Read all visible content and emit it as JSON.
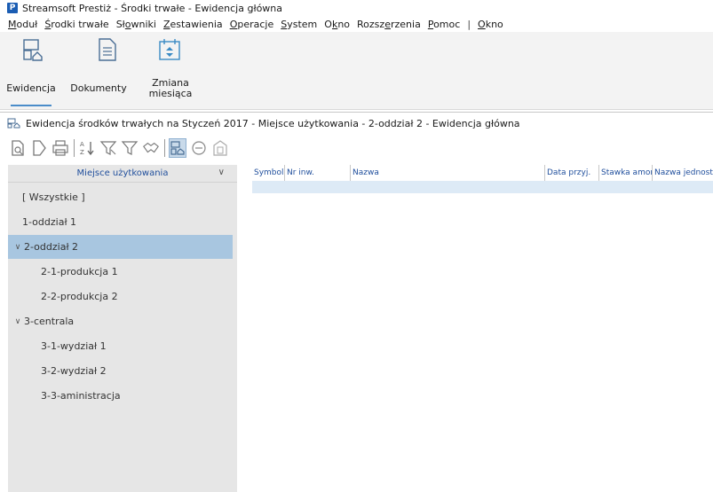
{
  "window": {
    "logo_letter": "P",
    "title": "Streamsoft Prestiż - Środki trwałe - Ewidencja główna"
  },
  "menu": [
    {
      "pre": "",
      "ul": "M",
      "post": "oduł"
    },
    {
      "pre": "",
      "ul": "Ś",
      "post": "rodki trwałe"
    },
    {
      "pre": "Sł",
      "ul": "o",
      "post": "wniki"
    },
    {
      "pre": "",
      "ul": "Z",
      "post": "estawienia"
    },
    {
      "pre": "",
      "ul": "O",
      "post": "peracje"
    },
    {
      "pre": "",
      "ul": "S",
      "post": "ystem"
    },
    {
      "pre": "O",
      "ul": "k",
      "post": "no"
    },
    {
      "pre": "Rozsz",
      "ul": "e",
      "post": "rzenia"
    },
    {
      "pre": "",
      "ul": "P",
      "post": "omoc"
    },
    {
      "sep": "|"
    },
    {
      "pre": "",
      "ul": "O",
      "post": "kno"
    }
  ],
  "ribbon": {
    "buttons": [
      {
        "label": "Ewidencja",
        "icon": "asset-register-icon"
      },
      {
        "label": "Dokumenty",
        "icon": "document-icon"
      },
      {
        "label": "Zmiana\nmiesiąca",
        "icon": "calendar-change-icon"
      }
    ]
  },
  "view": {
    "header": "Ewidencja środków trwałych na Styczeń 2017 - Miejsce użytkowania - 2-oddział 2 - Ewidencja główna"
  },
  "toolbar": {
    "icons": [
      "preview-icon",
      "new-document-icon",
      "print-icon",
      "sort-az-icon",
      "filter-icon",
      "filter-clear-icon",
      "handshake-icon",
      "asset-view-icon",
      "minus-circle-icon",
      "building-icon"
    ]
  },
  "left_panel": {
    "header": "Miejsce użytkowania",
    "items": [
      {
        "label": "[ Wszystkie ]",
        "indent": 0,
        "twisty": ""
      },
      {
        "label": "1-oddział 1",
        "indent": 0,
        "twisty": ""
      },
      {
        "label": "2-oddział 2",
        "indent": 0,
        "twisty": "∨",
        "selected": true
      },
      {
        "label": "2-1-produkcja 1",
        "indent": 1,
        "twisty": ""
      },
      {
        "label": "2-2-produkcja 2",
        "indent": 1,
        "twisty": ""
      },
      {
        "label": "3-centrala",
        "indent": 0,
        "twisty": "∨"
      },
      {
        "label": "3-1-wydział 1",
        "indent": 1,
        "twisty": ""
      },
      {
        "label": "3-2-wydział 2",
        "indent": 1,
        "twisty": ""
      },
      {
        "label": "3-3-aministracja",
        "indent": 1,
        "twisty": ""
      }
    ]
  },
  "grid": {
    "columns": [
      "Symbol",
      "Nr inw.",
      "Nazwa",
      "Data przyj.",
      "Stawka amort.",
      "Nazwa jednostki"
    ]
  },
  "colors": {
    "accent": "#4a8cc9",
    "selection": "#a8c6e0",
    "row_highlight": "#ddeaf6",
    "header_text": "#1f4e9c"
  }
}
